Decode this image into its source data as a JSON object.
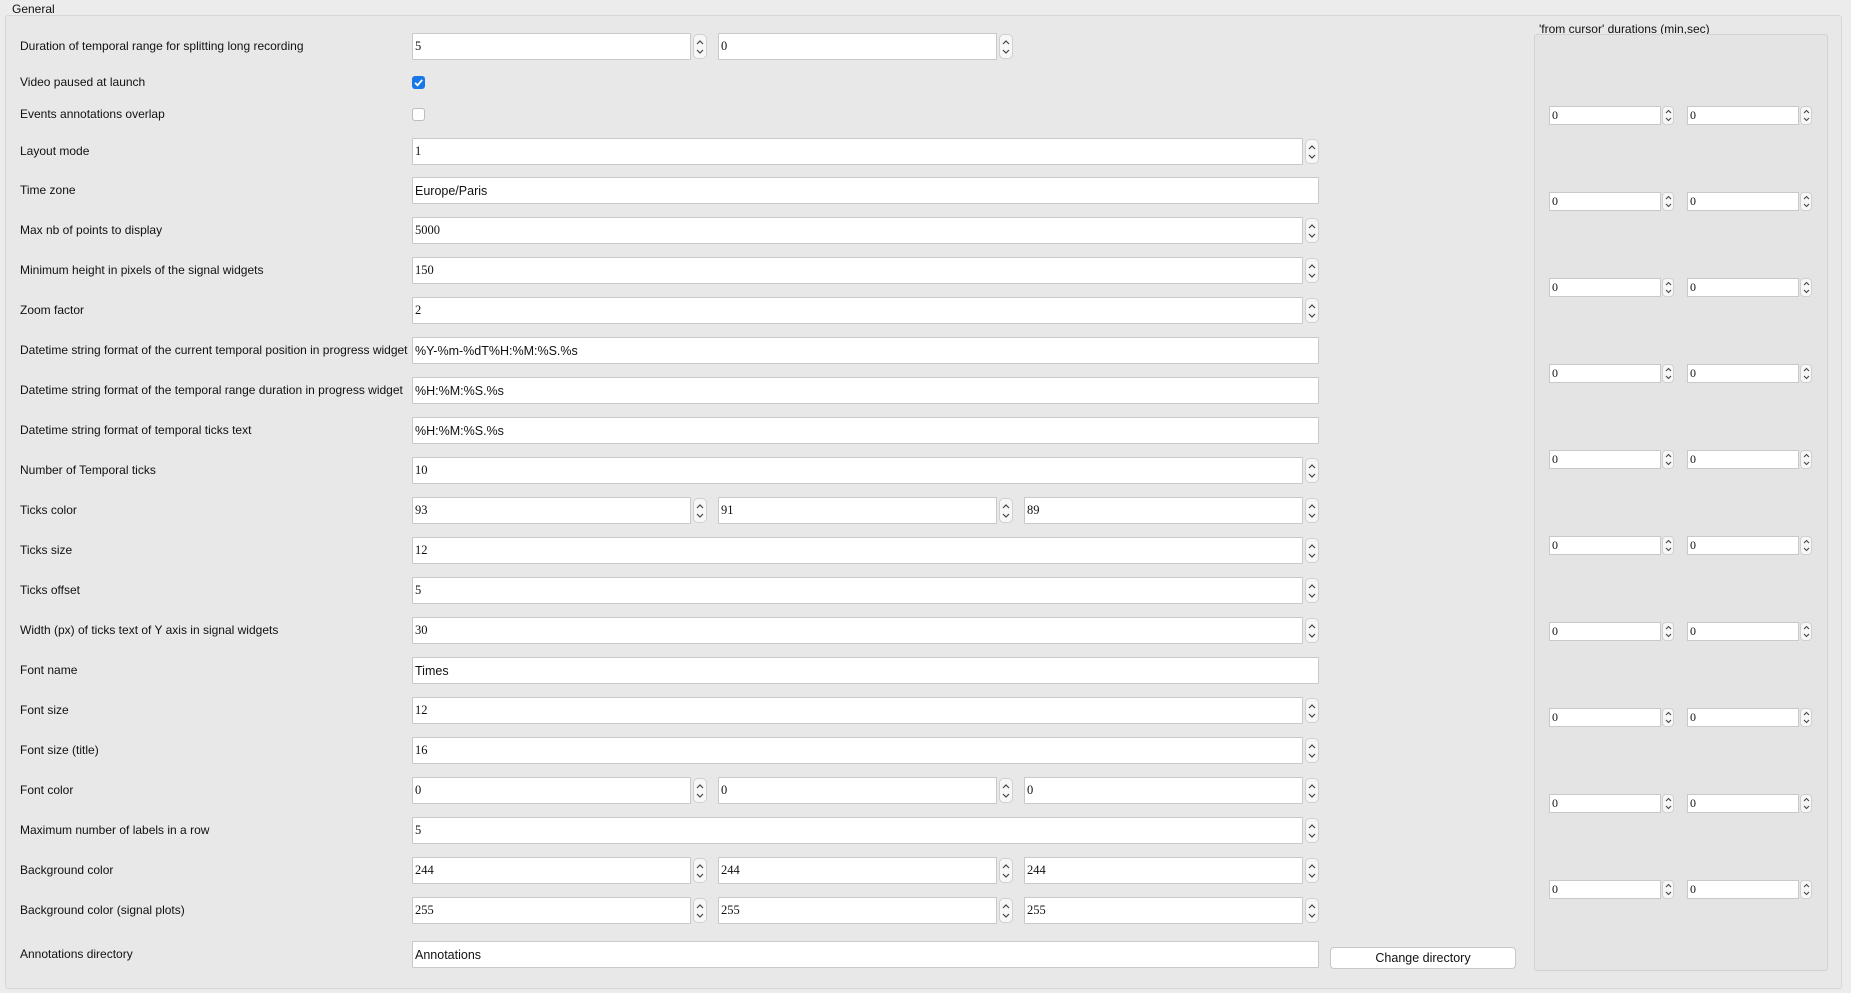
{
  "tab": {
    "title": "General"
  },
  "rows": [
    {
      "label": "Duration of temporal range for splitting long recording",
      "type": "spin2",
      "values": [
        "5",
        "0"
      ]
    },
    {
      "label": "Video paused at launch",
      "type": "check",
      "checked": true
    },
    {
      "label": "Events annotations overlap",
      "type": "check",
      "checked": false
    },
    {
      "label": "Layout mode",
      "type": "spin",
      "values": [
        "1"
      ]
    },
    {
      "label": "Time zone",
      "type": "text",
      "values": [
        "Europe/Paris"
      ]
    },
    {
      "label": "Max nb of points to display",
      "type": "spin",
      "values": [
        "5000"
      ]
    },
    {
      "label": "Minimum height in pixels of the signal widgets",
      "type": "spin",
      "values": [
        "150"
      ]
    },
    {
      "label": "Zoom factor",
      "type": "spin",
      "values": [
        "2"
      ]
    },
    {
      "label": "Datetime string format of the current temporal position in progress widget",
      "type": "text",
      "values": [
        "%Y-%m-%dT%H:%M:%S.%s"
      ]
    },
    {
      "label": "Datetime string format of the temporal range duration in progress widget",
      "type": "text",
      "values": [
        "%H:%M:%S.%s"
      ]
    },
    {
      "label": "Datetime string format of temporal ticks text",
      "type": "text",
      "values": [
        "%H:%M:%S.%s"
      ]
    },
    {
      "label": "Number of Temporal ticks",
      "type": "spin",
      "values": [
        "10"
      ]
    },
    {
      "label": "Ticks color",
      "type": "spin3",
      "values": [
        "93",
        "91",
        "89"
      ]
    },
    {
      "label": "Ticks size",
      "type": "spin",
      "values": [
        "12"
      ]
    },
    {
      "label": "Ticks offset",
      "type": "spin",
      "values": [
        "5"
      ]
    },
    {
      "label": "Width (px) of ticks text of Y axis in signal widgets",
      "type": "spin",
      "values": [
        "30"
      ]
    },
    {
      "label": "Font name",
      "type": "text",
      "values": [
        "Times"
      ]
    },
    {
      "label": "Font size",
      "type": "spin",
      "values": [
        "12"
      ]
    },
    {
      "label": "Font size (title)",
      "type": "spin",
      "values": [
        "16"
      ]
    },
    {
      "label": "Font color",
      "type": "spin3",
      "values": [
        "0",
        "0",
        "0"
      ]
    },
    {
      "label": "Maximum number of labels in a row",
      "type": "spin",
      "values": [
        "5"
      ]
    },
    {
      "label": "Background color",
      "type": "spin3",
      "values": [
        "244",
        "244",
        "244"
      ]
    },
    {
      "label": "Background color (signal plots)",
      "type": "spin3",
      "values": [
        "255",
        "255",
        "255"
      ]
    },
    {
      "label": "Annotations directory",
      "type": "dir",
      "values": [
        "Annotations"
      ]
    }
  ],
  "annotations_dir": {
    "button_label": "Change directory"
  },
  "from_cursor": {
    "title": "'from cursor' durations (min,sec)",
    "pairs": [
      [
        "0",
        "0"
      ],
      [
        "0",
        "0"
      ],
      [
        "0",
        "0"
      ],
      [
        "0",
        "0"
      ],
      [
        "0",
        "0"
      ],
      [
        "0",
        "0"
      ],
      [
        "0",
        "0"
      ],
      [
        "0",
        "0"
      ],
      [
        "0",
        "0"
      ],
      [
        "0",
        "0"
      ]
    ]
  }
}
